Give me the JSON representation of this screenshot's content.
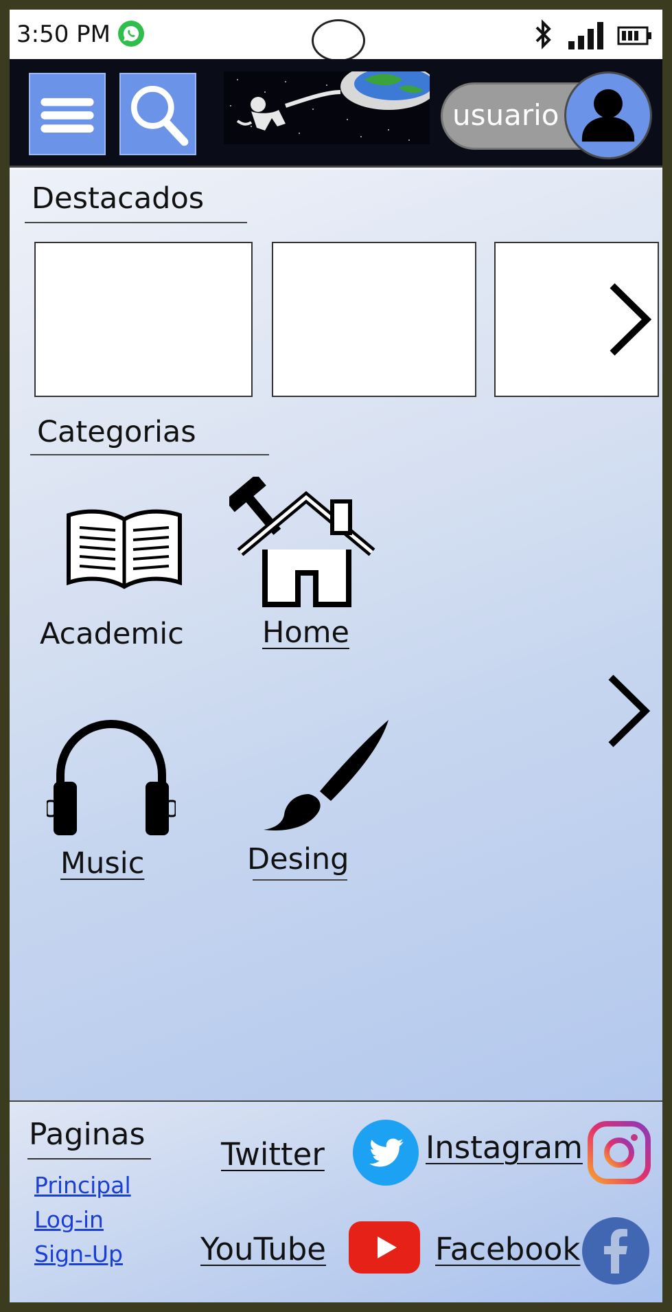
{
  "status_bar": {
    "time": "3:50 PM",
    "icons": [
      "whatsapp-icon",
      "bluetooth-icon",
      "signal-icon",
      "battery-icon"
    ]
  },
  "header": {
    "menu_icon": "hamburger-menu-icon",
    "search_icon": "search-icon",
    "banner": "astronaut-earth-banner",
    "user_label": "usuario",
    "avatar_icon": "user-avatar-icon"
  },
  "featured": {
    "title": "Destacados",
    "card_count_visible": 3
  },
  "categories": {
    "title": "Categorias",
    "items": [
      {
        "label": "Academic",
        "icon": "open-book-icon"
      },
      {
        "label": "Home",
        "icon": "house-hammer-icon"
      },
      {
        "label": "Music",
        "icon": "headphones-icon"
      },
      {
        "label": "Desing",
        "icon": "paintbrush-icon"
      }
    ]
  },
  "footer": {
    "pages_title": "Paginas",
    "pages": [
      "Principal",
      "Log-in",
      "Sign-Up"
    ],
    "social": [
      {
        "label": "Twitter",
        "icon": "twitter-icon",
        "color": "#1da1f2"
      },
      {
        "label": "Instagram",
        "icon": "instagram-icon",
        "color": "#e1306c"
      },
      {
        "label": "YouTube",
        "icon": "youtube-icon",
        "color": "#e62117"
      },
      {
        "label": "Facebook",
        "icon": "facebook-icon",
        "color": "#3b5998"
      }
    ]
  },
  "colors": {
    "accent": "#6b93e8",
    "header_bg": "#0a0d17",
    "link": "#1a3fd6"
  }
}
